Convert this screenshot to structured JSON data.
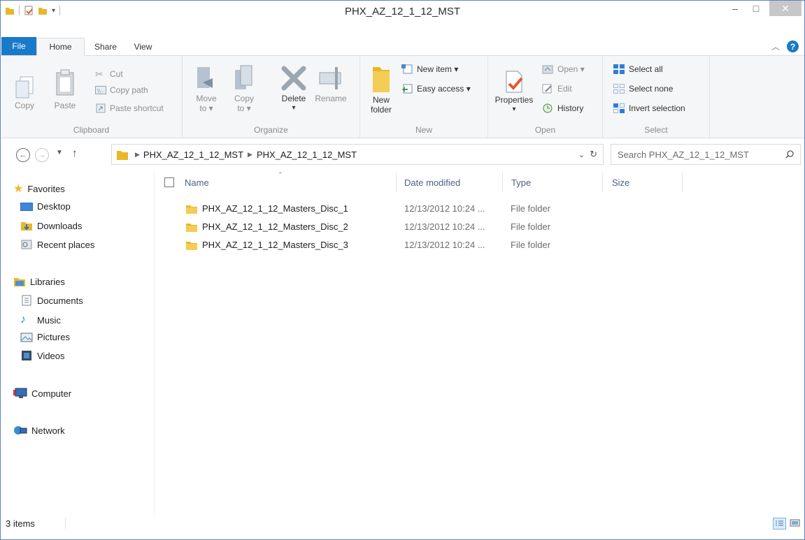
{
  "window": {
    "title": "PHX_AZ_12_1_12_MST",
    "controls": {
      "minimize": "–",
      "maximize": "□",
      "close": "✕"
    }
  },
  "tabs": [
    {
      "label": "File"
    },
    {
      "label": "Home"
    },
    {
      "label": "Share"
    },
    {
      "label": "View"
    }
  ],
  "ribbon": {
    "clipboard": {
      "label": "Clipboard",
      "copy": "Copy",
      "paste": "Paste",
      "cut": "Cut",
      "copy_path": "Copy path",
      "paste_shortcut": "Paste shortcut"
    },
    "organize": {
      "label": "Organize",
      "move_to_1": "Move",
      "move_to_2": "to ▾",
      "copy_to_1": "Copy",
      "copy_to_2": "to ▾",
      "delete": "Delete",
      "delete_arrow": "▾",
      "rename": "Rename"
    },
    "new": {
      "label": "New",
      "new_folder_1": "New",
      "new_folder_2": "folder",
      "new_item": "New item ▾",
      "easy_access": "Easy access ▾"
    },
    "open": {
      "label": "Open",
      "properties": "Properties",
      "properties_arrow": "▾",
      "open": "Open ▾",
      "edit": "Edit",
      "history": "History"
    },
    "select": {
      "label": "Select",
      "select_all": "Select all",
      "select_none": "Select none",
      "invert": "Invert selection"
    }
  },
  "address": {
    "crumbs": [
      "PHX_AZ_12_1_12_MST",
      "PHX_AZ_12_1_12_MST"
    ],
    "search_placeholder": "Search PHX_AZ_12_1_12_MST"
  },
  "nav": {
    "favorites": "Favorites",
    "desktop": "Desktop",
    "downloads": "Downloads",
    "recent": "Recent places",
    "libraries": "Libraries",
    "documents": "Documents",
    "music": "Music",
    "pictures": "Pictures",
    "videos": "Videos",
    "computer": "Computer",
    "network": "Network"
  },
  "columns": {
    "name": "Name",
    "date": "Date modified",
    "type": "Type",
    "size": "Size"
  },
  "files": [
    {
      "name": "PHX_AZ_12_1_12_Masters_Disc_1",
      "date": "12/13/2012 10:24 ...",
      "type": "File folder"
    },
    {
      "name": "PHX_AZ_12_1_12_Masters_Disc_2",
      "date": "12/13/2012 10:24 ...",
      "type": "File folder"
    },
    {
      "name": "PHX_AZ_12_1_12_Masters_Disc_3",
      "date": "12/13/2012 10:24 ...",
      "type": "File folder"
    }
  ],
  "status": {
    "items": "3 items"
  },
  "colors": {
    "accent": "#1979ca",
    "folder": "#e8b829"
  }
}
